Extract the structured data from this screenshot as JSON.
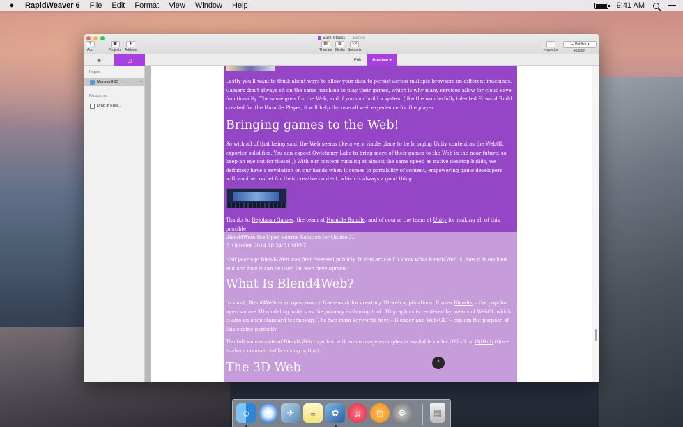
{
  "menubar": {
    "app_name": "RapidWeaver 6",
    "items": [
      "File",
      "Edit",
      "Format",
      "View",
      "Window",
      "Help"
    ],
    "clock": "9:41 AM"
  },
  "window": {
    "title": "Barz-Stacks",
    "title_separator": "—",
    "title_state": "Edited",
    "toolbar": {
      "add": "Add",
      "projects": "Projects",
      "addons": "Addons",
      "themes": "Themes",
      "media": "Media",
      "snippets": "Snippets",
      "inspector": "Inspector",
      "publish_button": "Publish",
      "publish_label": "Publish"
    },
    "mode_tabs": {
      "edit": "Edit",
      "preview": "Preview"
    }
  },
  "sidebar": {
    "pages_heading": "Pages",
    "page_item": "MonsterRSS",
    "resources_heading": "Resources",
    "resource_item": "Drag in Files..."
  },
  "preview": {
    "article1": {
      "para1": "Lastly you'll want to think about ways to allow your data to persist across multiple browsers on different machines. Gamers don't always sit on the same machine to play their games, which is why many services allow for cloud save functionality. The same goes for the Web, and if you can build a system (like the wonderfully talented Edward Rudd created for the Humble Player, it will help the overall web experience for the player.",
      "heading": "Bringing games to the Web!",
      "para2": "So with all of that being said, the Web seems like a very viable place to be bringing Unity content as the WebGL exporter solidifies. You can expect Owlchemy Labs to bring more of their games to the Web in the near future, so keep an eye out for those! ;) With our content running at almost the same speed as native desktop builds, we definitely have a revolution on our hands when it comes to portability of content, empowering game developers with another outlet for their creative content, which is always a good thing.",
      "thanks_prefix": "Thanks to ",
      "thanks_link1": "Dejobaan Games",
      "thanks_mid1": ", the team at ",
      "thanks_link2": "Humble Bundle",
      "thanks_mid2": ", and of course the team at ",
      "thanks_link3": "Unity",
      "thanks_suffix": " for making all of this possible!"
    },
    "article2": {
      "title_link": "Blend4Web: the Open Source Solution for Online 3D",
      "date": "7. Oktober 2014 18:34:51 MESZ",
      "para1": "Half year ago Blend4Web was first released publicly. In this article I'll show what Blend4Web is, how it is evolved and and how it can be used for web development.",
      "heading1": "What Is Blend4Web?",
      "para2_prefix": "In short, Blend4Web is an open source framework for creating 3D web applications. It uses ",
      "para2_link": "Blender",
      "para2_suffix": " – the popular open source 3D modeling suite – as the primary authoring tool. 3D graphics is rendered by means of WebGL which is also an open standard technology. The two main keywords here – Blender and Web(GL) – explain the purpose of this engine perfectly.",
      "para3_prefix": "The full source code of Blend4Web together with some usage examples is available under GPLv3 on ",
      "para3_link": "GitHub",
      "para3_suffix": " (there is also a commercial licensing option).",
      "heading2": "The 3D Web"
    },
    "scroll_top_glyph": "^"
  },
  "dock": {
    "apps": [
      "finder",
      "safari",
      "preview",
      "notes",
      "rapidweaver",
      "itunes",
      "ibooks",
      "system-preferences",
      "trash"
    ]
  },
  "colors": {
    "accent": "#a840e0",
    "article_dark": "#9446c6",
    "article_light": "#c69cdb"
  }
}
